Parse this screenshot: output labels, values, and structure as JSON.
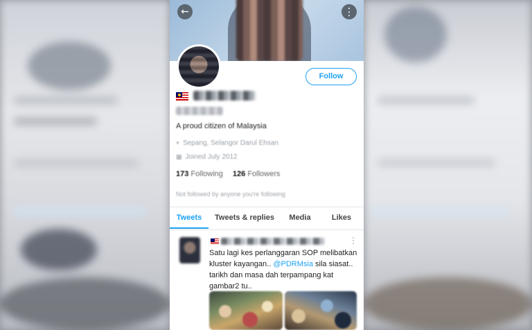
{
  "header": {
    "back_icon": "arrow-left-icon",
    "more_icon": "more-vertical-icon",
    "back_glyph": "←",
    "more_glyph": "⋮"
  },
  "profile": {
    "follow_label": "Follow",
    "bio": "A proud citizen of Malaysia",
    "location": "Sepang, Selangor Darul Ehsan",
    "joined": "Joined July 2012",
    "following_count": "173",
    "following_label": "Following",
    "followers_count": "126",
    "followers_label": "Followers",
    "not_followed_text": "Not followed by anyone you're following",
    "location_glyph": "⌖",
    "joined_glyph": "▦"
  },
  "tabs": [
    {
      "label": "Tweets",
      "active": true
    },
    {
      "label": "Tweets & replies",
      "active": false
    },
    {
      "label": "Media",
      "active": false
    },
    {
      "label": "Likes",
      "active": false
    }
  ],
  "tweet": {
    "more_glyph": "⋮",
    "text_before_mention": "Satu lagi kes perlanggaran SOP melibatkan kluster kayangan.. ",
    "mention": "@PDRMsia",
    "text_after_mention": " sila siasat.. tarikh dan masa dah terpampang kat gambar2 tu.."
  },
  "colors": {
    "accent": "#1da1f2",
    "text": "#222222",
    "muted": "#9aa0a6"
  }
}
